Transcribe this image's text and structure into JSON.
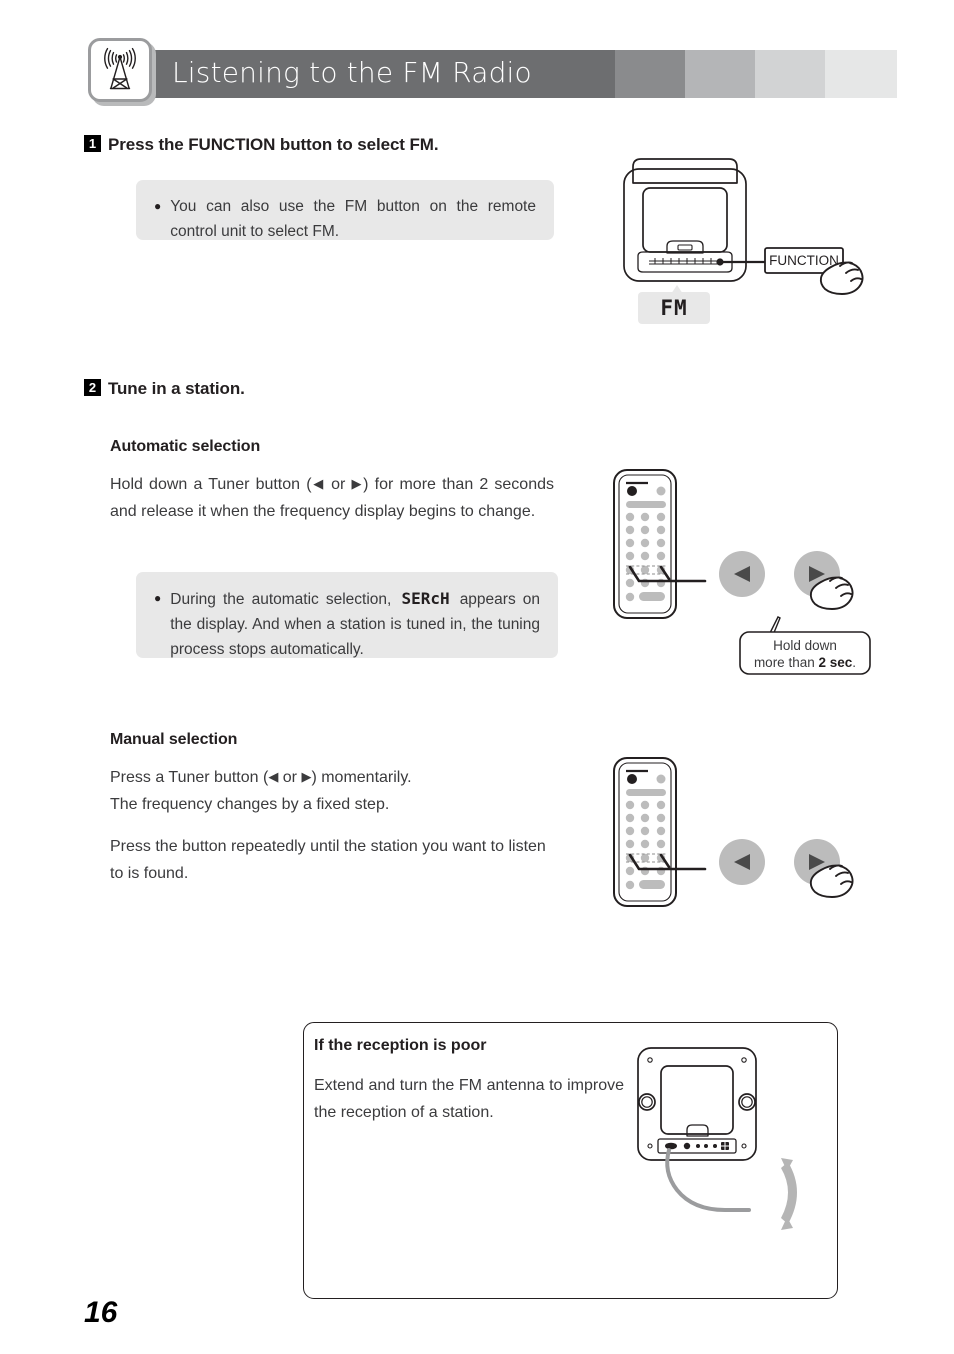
{
  "header": {
    "title": "Listening to the FM Radio",
    "icon": "antenna-tower-icon",
    "segment_colors": [
      "#6d6e70",
      "#8a8b8d",
      "#b4b5b7",
      "#d2d3d4",
      "#e6e7e7"
    ]
  },
  "steps": [
    {
      "number": "1",
      "heading": "Press the FUNCTION button to select FM.",
      "note": {
        "bullet": "●",
        "text": "You can also use the FM button on the remote control unit to select FM."
      }
    },
    {
      "number": "2",
      "heading": "Tune in a station."
    }
  ],
  "automatic": {
    "heading": "Automatic selection",
    "body_before": "Hold down a Tuner button (",
    "tri_left": "◀",
    "body_or": " or ",
    "tri_right": "▶",
    "body_after": ") for more than 2 seconds and release it when the frequency display begins to change.",
    "note": {
      "bullet": "●",
      "text_before": "During the automatic selection,",
      "lcd": "SERcH",
      "text_after": "appears on the display. And when a station is tuned in, the tuning process stops automatically."
    }
  },
  "manual": {
    "heading": "Manual selection",
    "para1_before": "Press a Tuner button (",
    "tri_left": "◀",
    "para1_or": " or ",
    "tri_right": "▶",
    "para1_after": ") momentarily.\nThe frequency changes by a fixed step.",
    "para2": "Press the button repeatedly until the station you want to listen to is found."
  },
  "device_illustration": {
    "callout_label": "FUNCTION",
    "display_text": "FM"
  },
  "tuner_callout": {
    "line1": "Hold down",
    "line2_prefix": "more than ",
    "line2_bold": "2 sec",
    "line2_suffix": "."
  },
  "reception_box": {
    "heading": "If the reception is poor",
    "text": "Extend and turn the FM antenna to improve the reception of a station."
  },
  "page_number": "16",
  "colors": {
    "header_dark": "#6d6e70",
    "note_bg": "#e8e8e8",
    "button_gray": "#bcbcbc",
    "ink": "#231f20",
    "body_text": "#3b3b3d"
  }
}
